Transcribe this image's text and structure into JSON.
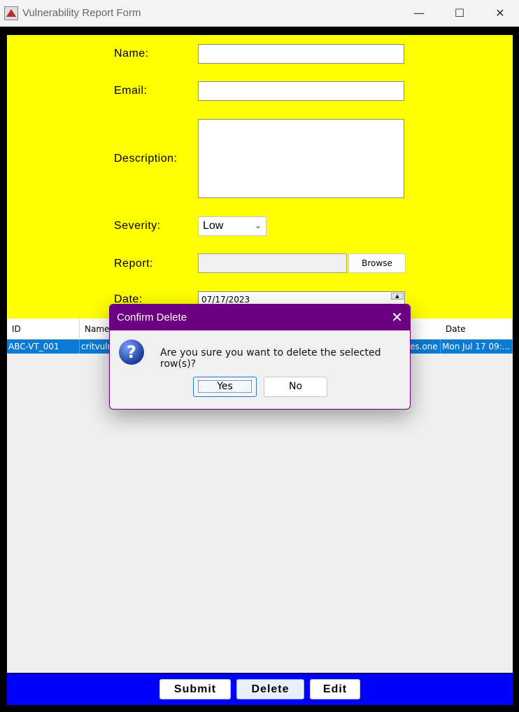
{
  "window": {
    "title": "Vulnerability Report Form",
    "minimize_glyph": "—",
    "maximize_glyph": "☐",
    "close_glyph": "✕"
  },
  "form": {
    "name_label": "Name:",
    "email_label": "Email:",
    "description_label": "Description:",
    "severity_label": "Severity:",
    "severity_value": "Low",
    "report_label": "Report:",
    "browse_label": "Browse",
    "date_label": "Date:",
    "date_value": "07/17/2023"
  },
  "table": {
    "columns": [
      "ID",
      "Name",
      "Date"
    ],
    "row": {
      "id": "ABC-VT_001",
      "name": "critvuln",
      "email_tail": "es.one",
      "date": "Mon Jul 17 09:..."
    }
  },
  "buttons": {
    "submit": "Submit",
    "delete": "Delete",
    "edit": "Edit"
  },
  "dialog": {
    "title": "Confirm Delete",
    "message": "Are you sure you want to delete the selected row(s)?",
    "yes": "Yes",
    "no": "No",
    "icon": "question-icon"
  },
  "colors": {
    "form_bg": "#ffff00",
    "bottom_bar": "#0000ff",
    "dialog_title": "#6b0080",
    "selection": "#0a7ad4"
  }
}
